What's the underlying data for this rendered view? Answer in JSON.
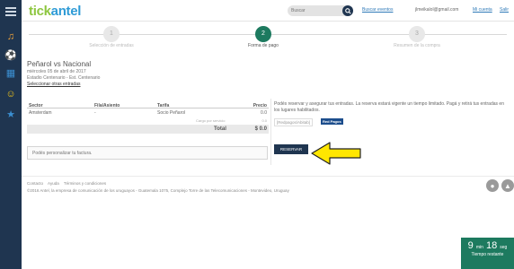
{
  "colors": {
    "nav_bg": "#1f3550",
    "accent_green": "#1d7a5f",
    "logo_green": "#8dc63f",
    "logo_blue": "#2f9bd6",
    "arrow": "#ffe600"
  },
  "sidebar": {
    "menu_icon": "hamburger-icon",
    "items": [
      {
        "icon": "music-note-icon",
        "glyph": "♫",
        "color": "#f2a43a"
      },
      {
        "icon": "sports-ball-icon",
        "glyph": "⚽",
        "color": "#7fc241"
      },
      {
        "icon": "theater-icon",
        "glyph": "▦",
        "color": "#3b8fd1"
      },
      {
        "icon": "smiley-icon",
        "glyph": "☺",
        "color": "#f0c419"
      },
      {
        "icon": "star-icon",
        "glyph": "★",
        "color": "#3b8fd1"
      }
    ]
  },
  "header": {
    "logo_part1": "tick",
    "logo_part2": "antel",
    "search_placeholder": "Buscar",
    "link_events": "Buscar eventos",
    "email": "jlmeikalol@gmail.com",
    "link_account": "Mi cuenta",
    "link_logout": "Salir"
  },
  "steps": [
    {
      "number": "1",
      "label": "Selección de entradas"
    },
    {
      "number": "2",
      "label": "Forma de pago"
    },
    {
      "number": "3",
      "label": "Resumen de la compra"
    }
  ],
  "event": {
    "title": "Peñarol vs Nacional",
    "date": "miércoles 05 de abril de 2017",
    "venue": "Estadio Centenario - Est. Centenario",
    "change_link": "Seleccionar otras entradas"
  },
  "table": {
    "headers": [
      "Sector",
      "Fila/Asiento",
      "Tarifa",
      "Precio"
    ],
    "rows": [
      [
        "Amsterdam",
        "-",
        "Socio Peñarol",
        "0.0"
      ]
    ],
    "service_label": "Cargo por servicio",
    "service_value": "0.0",
    "total_label": "Total",
    "total_value": "$ 0.0",
    "factura_placeholder": "Podés personalizar tu factura."
  },
  "payment": {
    "text": "Podés reservar y asegurar tus entradas. La reserva estará vigente un tiempo limitado. Pagá y retirá tus entradas en los lugares habilitados.",
    "image_alt": "[Redpagos/Abitab]",
    "badge": "Red Pagos",
    "button": "RESERVAR"
  },
  "footer": {
    "links": [
      "Contacto",
      "Ayuda",
      "Términos y condiciones"
    ],
    "copyright": "©2016 Antel, la empresa de comunicación de los uruguayos - Guatemala 1075, Complejo Torre de las Telecomunicaciones - Montevideo, Uruguay"
  },
  "timer": {
    "minutes": "9",
    "min_label": "min",
    "seconds": "18",
    "sec_label": "seg",
    "caption": "Tiempo restante"
  }
}
